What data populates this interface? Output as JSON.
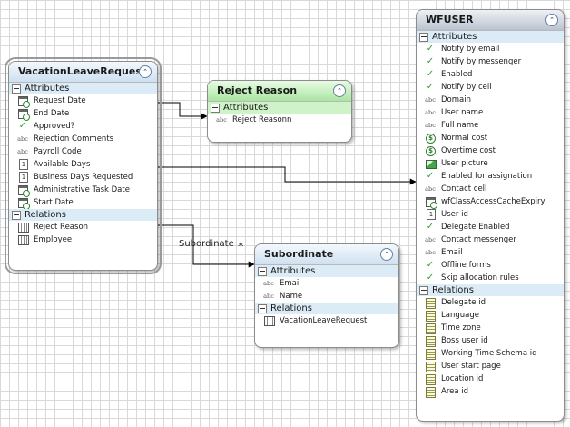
{
  "entities": {
    "vacation": {
      "title": "VacationLeaveRequest",
      "attributes_label": "Attributes",
      "attributes": [
        {
          "name": "Request Date",
          "icon": "date"
        },
        {
          "name": "End Date",
          "icon": "date"
        },
        {
          "name": "Approved?",
          "icon": "check"
        },
        {
          "name": "Rejection Comments",
          "icon": "text"
        },
        {
          "name": "Payroll Code",
          "icon": "text"
        },
        {
          "name": "Available Days",
          "icon": "number"
        },
        {
          "name": "Business Days Requested",
          "icon": "number"
        },
        {
          "name": "Administrative Task Date",
          "icon": "date"
        },
        {
          "name": "Start Date",
          "icon": "date"
        }
      ],
      "relations_label": "Relations",
      "relations": [
        {
          "name": "Reject Reason",
          "icon": "table"
        },
        {
          "name": "Employee",
          "icon": "table"
        }
      ]
    },
    "reject": {
      "title": "Reject Reason",
      "attributes_label": "Attributes",
      "attributes": [
        {
          "name": "Reject Reasonn",
          "icon": "text"
        }
      ]
    },
    "subordinate": {
      "title": "Subordinate",
      "attributes_label": "Attributes",
      "attributes": [
        {
          "name": "Email",
          "icon": "text"
        },
        {
          "name": "Name",
          "icon": "text"
        }
      ],
      "relations_label": "Relations",
      "relations": [
        {
          "name": "VacationLeaveRequest",
          "icon": "table"
        }
      ]
    },
    "wfuser": {
      "title": "WFUSER",
      "attributes_label": "Attributes",
      "attributes": [
        {
          "name": "Notify by email",
          "icon": "check"
        },
        {
          "name": "Notify by messenger",
          "icon": "check"
        },
        {
          "name": "Enabled",
          "icon": "check"
        },
        {
          "name": "Notify by cell",
          "icon": "check"
        },
        {
          "name": "Domain",
          "icon": "text"
        },
        {
          "name": "User name",
          "icon": "text"
        },
        {
          "name": "Full name",
          "icon": "text"
        },
        {
          "name": "Normal cost",
          "icon": "money"
        },
        {
          "name": "Overtime cost",
          "icon": "money"
        },
        {
          "name": "User picture",
          "icon": "picture"
        },
        {
          "name": "Enabled for assignation",
          "icon": "check"
        },
        {
          "name": "Contact cell",
          "icon": "text"
        },
        {
          "name": "wfClassAccessCacheExpiry",
          "icon": "date"
        },
        {
          "name": "User id",
          "icon": "number"
        },
        {
          "name": "Delegate Enabled",
          "icon": "check"
        },
        {
          "name": "Contact messenger",
          "icon": "text"
        },
        {
          "name": "Email",
          "icon": "text"
        },
        {
          "name": "Offline forms",
          "icon": "check"
        },
        {
          "name": "Skip allocation rules",
          "icon": "check"
        }
      ],
      "relations_label": "Relations",
      "relations": [
        {
          "name": "Delegate id",
          "icon": "relation"
        },
        {
          "name": "Language",
          "icon": "relation"
        },
        {
          "name": "Time zone",
          "icon": "relation"
        },
        {
          "name": "Boss user id",
          "icon": "relation"
        },
        {
          "name": "Working Time Schema id",
          "icon": "relation"
        },
        {
          "name": "User start page",
          "icon": "relation"
        },
        {
          "name": "Location id",
          "icon": "relation"
        },
        {
          "name": "Area id",
          "icon": "relation"
        }
      ]
    }
  },
  "connectors": {
    "subordinate_label": "Subordinate",
    "multiplicity": "*"
  },
  "icons": {
    "collapse": "⌃",
    "check": "✓",
    "text": "abc",
    "number": "1",
    "money": "$"
  }
}
